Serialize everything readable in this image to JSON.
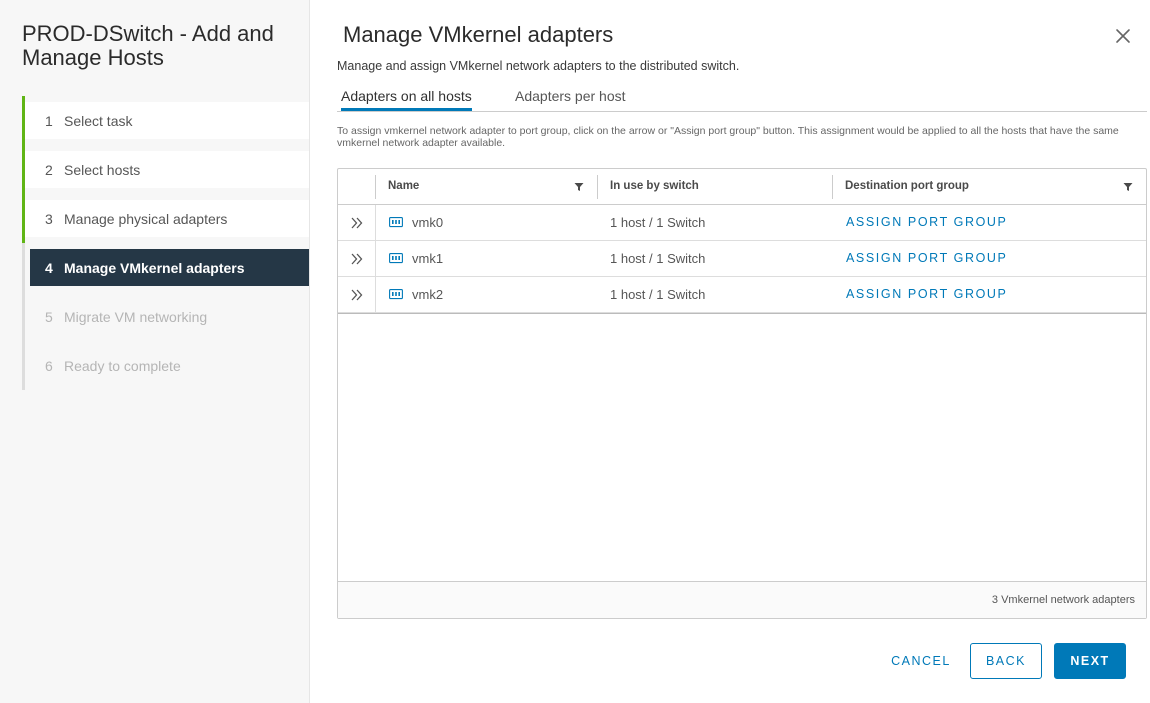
{
  "wizard": {
    "title": "PROD-DSwitch - Add and Manage Hosts",
    "steps": [
      {
        "number": "1",
        "label": "Select task",
        "state": "completed"
      },
      {
        "number": "2",
        "label": "Select hosts",
        "state": "completed"
      },
      {
        "number": "3",
        "label": "Manage physical adapters",
        "state": "completed"
      },
      {
        "number": "4",
        "label": "Manage VMkernel adapters",
        "state": "current"
      },
      {
        "number": "5",
        "label": "Migrate VM networking",
        "state": "disabled"
      },
      {
        "number": "6",
        "label": "Ready to complete",
        "state": "disabled"
      }
    ]
  },
  "page": {
    "title": "Manage VMkernel adapters",
    "subtitle": "Manage and assign VMkernel network adapters to the distributed switch.",
    "hint": "To assign vmkernel network adapter to port group, click on the arrow or \"Assign port group\" button. This assignment would be applied to all the hosts that have the same vmkernel network adapter available."
  },
  "tabs": [
    {
      "label": "Adapters on all hosts",
      "active": true
    },
    {
      "label": "Adapters per host",
      "active": false
    }
  ],
  "grid": {
    "columns": [
      "Name",
      "In use by switch",
      "Destination port group"
    ],
    "rows": [
      {
        "name": "vmk0",
        "in_use": "1 host / 1 Switch",
        "action": "ASSIGN PORT GROUP"
      },
      {
        "name": "vmk1",
        "in_use": "1 host / 1 Switch",
        "action": "ASSIGN PORT GROUP"
      },
      {
        "name": "vmk2",
        "in_use": "1 host / 1 Switch",
        "action": "ASSIGN PORT GROUP"
      }
    ],
    "footer": "3 Vmkernel network adapters"
  },
  "buttons": {
    "cancel": "CANCEL",
    "back": "BACK",
    "next": "NEXT"
  },
  "colors": {
    "accent": "#0079b8",
    "completed": "#60b515",
    "current_step_bg": "#253746"
  },
  "icons": {
    "close": "close-icon",
    "filter": "filter-icon",
    "expand": "double-chevron-right-icon",
    "adapter": "network-adapter-icon"
  }
}
